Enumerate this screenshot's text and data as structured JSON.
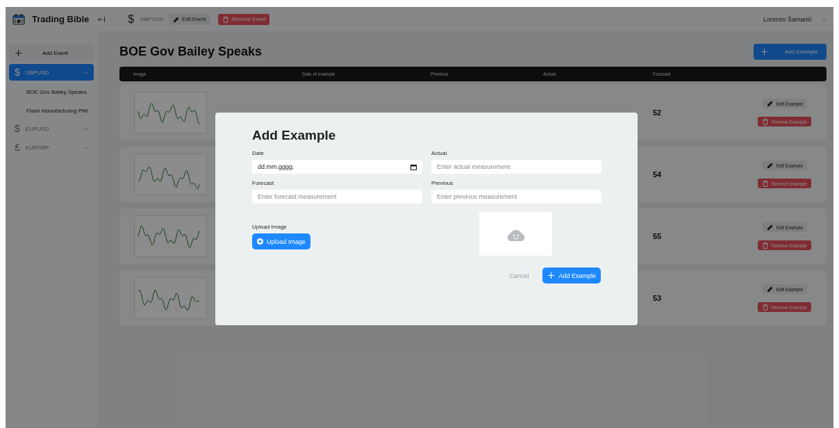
{
  "topbar": {
    "app_title": "Trading Bible",
    "currency_symbol": "$",
    "currency": "GBPUSD",
    "edit_button": "Edit Event",
    "remove_button": "Remove Event",
    "user": "Lorenzo Šamanić"
  },
  "sidebar": {
    "add_button": "Add Event",
    "items": [
      {
        "symbol": "$",
        "label": "GBPUSD",
        "selected": true,
        "expanded": true,
        "children": [
          {
            "label": "BOE Gov Bailey Speaks"
          },
          {
            "label": "Flash Manufacturing PMI"
          }
        ]
      },
      {
        "symbol": "$",
        "label": "EURUSD",
        "selected": false,
        "expanded": false
      },
      {
        "symbol": "£",
        "label": "EURGBP",
        "selected": false,
        "expanded": false
      }
    ]
  },
  "page": {
    "title": "BOE Gov Bailey Speaks",
    "add_button": "Add Example"
  },
  "table": {
    "columns": [
      "Image",
      "Date of example",
      "Previous",
      "Actual",
      "Forecast"
    ],
    "rows": [
      {
        "forecast": "52",
        "edit_button": "Edit Example",
        "remove_button": "Remove Example"
      },
      {
        "forecast": "54",
        "edit_button": "Edit Example",
        "remove_button": "Remove Example"
      },
      {
        "forecast": "55",
        "edit_button": "Edit Example",
        "remove_button": "Remove Example"
      },
      {
        "forecast": "53",
        "edit_button": "Edit Example",
        "remove_button": "Remove Example"
      }
    ]
  },
  "modal": {
    "title": "Add Example",
    "fields": [
      {
        "kind": "date",
        "label": "Date",
        "value": "dd.mm.gggg."
      },
      {
        "kind": "text",
        "label": "Actual",
        "placeholder": "Enter actual measurement"
      },
      {
        "kind": "text",
        "label": "Forecast",
        "placeholder": "Enter forecast measurement"
      },
      {
        "kind": "text",
        "label": "Previous",
        "placeholder": "Enter previous measurement"
      }
    ],
    "upload_label": "Upload Image",
    "upload_button": "Upload Image",
    "cancel_button": "Cancel",
    "submit_button": "Add Example"
  }
}
